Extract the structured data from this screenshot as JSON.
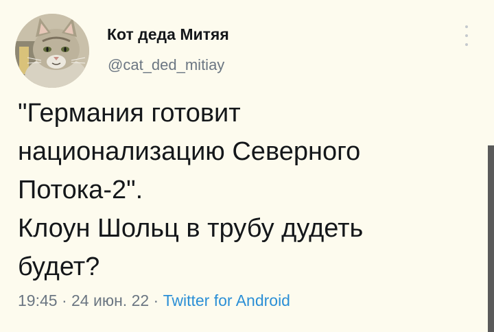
{
  "tweet": {
    "display_name": "Кот деда Митяя",
    "handle": "@cat_ded_mitiay",
    "text_lines": [
      "\"Германия готовит",
      "национализацию Северного",
      "Потока-2\".",
      "Клоун Шольц в трубу дудеть",
      "будет?"
    ],
    "time": "19:45",
    "separator": " · ",
    "date": "24 июн. 22",
    "source": "Twitter for Android"
  },
  "icons": {
    "more": "more-vertical-icon",
    "avatar": "cat-avatar"
  },
  "colors": {
    "background": "#fdfbee",
    "text": "#14171a",
    "muted": "#6b7682",
    "link": "#2b8fd6"
  }
}
